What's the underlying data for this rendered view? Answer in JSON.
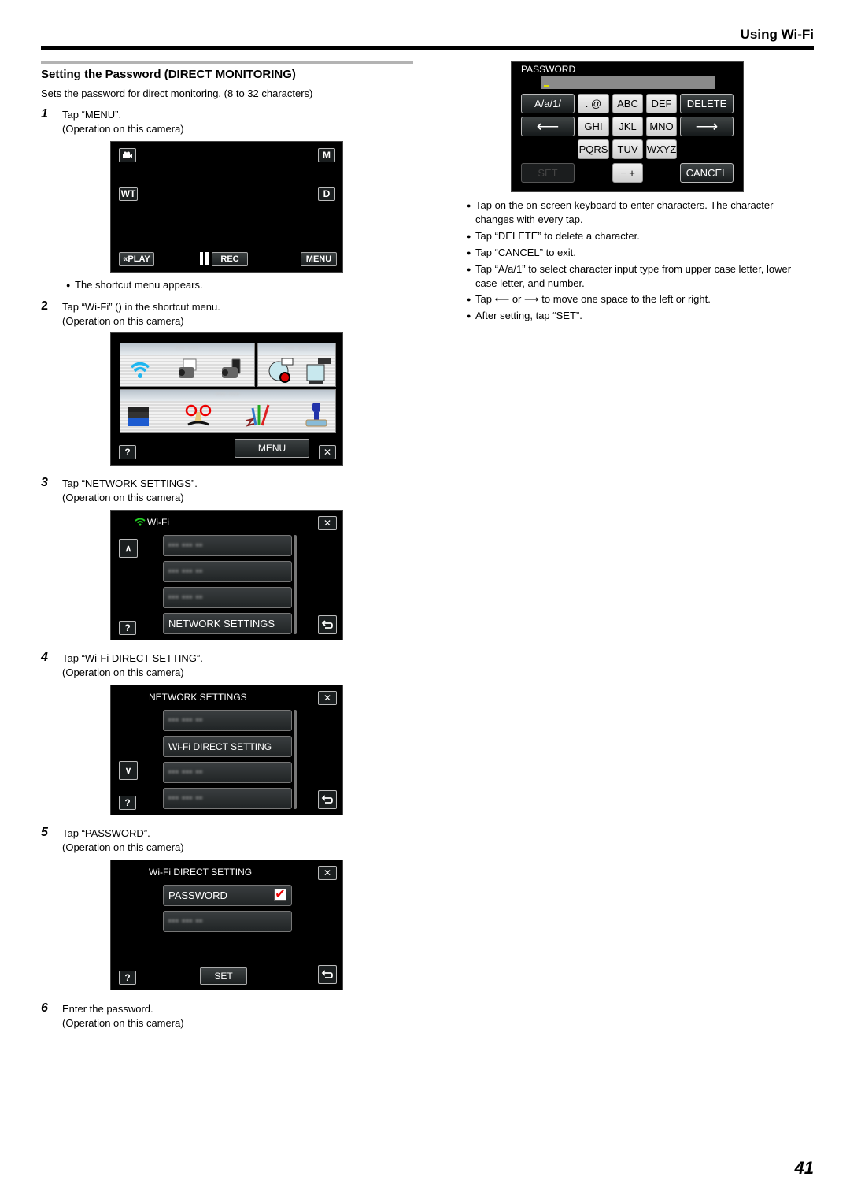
{
  "header": {
    "title": "Using Wi-Fi"
  },
  "section": {
    "title": "Setting the Password (DIRECT MONITORING)",
    "intro": "Sets the password for direct monitoring. (8 to 32 characters)"
  },
  "steps": [
    {
      "num": "1",
      "line1": "Tap “MENU”.",
      "line2": "(Operation on this camera)"
    },
    {
      "num": "2",
      "line1": "Tap “Wi-Fi” () in the shortcut menu.",
      "line2": "(Operation on this camera)"
    },
    {
      "num": "3",
      "line1": "Tap “NETWORK SETTINGS”.",
      "line2": "(Operation on this camera)"
    },
    {
      "num": "4",
      "line1": "Tap “Wi-Fi DIRECT SETTING”.",
      "line2": "(Operation on this camera)"
    },
    {
      "num": "5",
      "line1": "Tap “PASSWORD”.",
      "line2": "(Operation on this camera)"
    },
    {
      "num": "6",
      "line1": "Enter the password.",
      "line2": "(Operation on this camera)"
    }
  ],
  "step1_note": "The shortcut menu appears.",
  "screen1": {
    "mode_icon": "video-camera-icon",
    "m": "M",
    "wt": "WT",
    "d": "D",
    "play": "«PLAY",
    "rec": "REC",
    "menu": "MENU"
  },
  "screen2": {
    "menu": "MENU",
    "help": "?",
    "close": "✕",
    "tiles_top": [
      "wifi-icon",
      "camera-send-icon",
      "camera-phone-icon"
    ],
    "tiles_right": [
      "rec-off-icon",
      "name-on-icon"
    ],
    "tiles_bottom": [
      "clapperboard-icon",
      "funny-glasses-icon",
      "pens-icon",
      "stamp-icon"
    ]
  },
  "screen3": {
    "title": "Wi-Fi",
    "items": [
      "▪▪▪ ▪▪▪ ▪▪",
      "▪▪▪ ▪▪▪ ▪▪",
      "▪▪▪ ▪▪▪ ▪▪",
      "NETWORK SETTINGS"
    ],
    "help": "?",
    "close": "✕",
    "up": "∧",
    "back": "⮌"
  },
  "screen4": {
    "title": "NETWORK SETTINGS",
    "items": [
      "▪▪▪ ▪▪▪ ▪▪",
      "Wi-Fi DIRECT SETTING",
      "▪▪▪ ▪▪▪ ▪▪",
      "▪▪▪ ▪▪▪ ▪▪"
    ],
    "help": "?",
    "close": "✕",
    "down": "∨",
    "back": "⮌"
  },
  "screen5": {
    "title": "Wi-Fi DIRECT SETTING",
    "items": [
      "PASSWORD",
      "▪▪▪ ▪▪▪ ▪▪"
    ],
    "set": "SET",
    "help": "?",
    "close": "✕",
    "back": "⮌",
    "check": "✔"
  },
  "keyboard": {
    "title": "PASSWORD",
    "cursor": "_",
    "keys": {
      "mode": "A/a/1/",
      "dot_at": ". @",
      "abc": "ABC",
      "def": "DEF",
      "delete": "DELETE",
      "left": "⟵",
      "ghi": "GHI",
      "jkl": "JKL",
      "mno": "MNO",
      "right": "⟶",
      "pqrs": "PQRS",
      "tuv": "TUV",
      "wxyz": "WXYZ",
      "set": "SET",
      "minus_plus": "− +",
      "cancel": "CANCEL"
    }
  },
  "notes": [
    "Tap on the on-screen keyboard to enter characters. The character",
    "changes with every tap.",
    "Tap “DELETE” to delete a character.",
    "Tap “CANCEL” to exit.",
    "Tap “A/a/1” to select character input type from upper case letter, lower",
    "case letter, and number.",
    "Tap ⟵ or ⟶ to move one space to the left or right.",
    "After setting, tap “SET”."
  ],
  "page_number": "41"
}
